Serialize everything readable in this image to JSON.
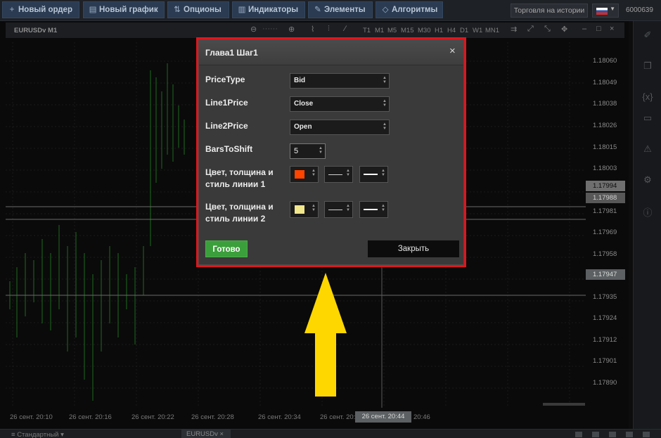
{
  "toolbar": {
    "new_order": "Новый ордер",
    "new_chart": "Новый график",
    "options": "Опционы",
    "indicators": "Индикаторы",
    "elements": "Элементы",
    "algorithms": "Алгоритмы",
    "history_trading": "Торговля на истории",
    "account_id": "6000639"
  },
  "chart": {
    "symbol": "EURUSDv M1",
    "timeframes": [
      "T1",
      "M1",
      "M5",
      "M15",
      "M30",
      "H1",
      "H4",
      "D1",
      "W1",
      "MN1"
    ],
    "price_labels": [
      "1.18060",
      "1.18049",
      "1.18038",
      "1.18026",
      "1.18015",
      "1.18003",
      "1.17981",
      "1.17969",
      "1.17958",
      "1.17935",
      "1.17924",
      "1.17912",
      "1.17901",
      "1.17890"
    ],
    "highlight_prices": [
      "1.17994",
      "1.17988",
      "1.17947"
    ],
    "time_labels": [
      "26 сент. 20:10",
      "26 сент. 20:16",
      "26 сент. 20:22",
      "26 сент. 20:28",
      "26 сент. 20:34",
      "26 сент. 20:40",
      "20:46"
    ],
    "crosshair_time": "26 сент. 20:44"
  },
  "dialog": {
    "title": "Глава1 Шаг1",
    "close_symbol": "×",
    "price_type": {
      "label": "PriceType",
      "value": "Bid"
    },
    "line1_price": {
      "label": "Line1Price",
      "value": "Close"
    },
    "line2_price": {
      "label": "Line2Price",
      "value": "Open"
    },
    "bars_to_shift": {
      "label": "BarsToShift",
      "value": "5"
    },
    "line1_style": {
      "label": "Цвет, толщина и стиль линии 1",
      "color": "#ff4400"
    },
    "line2_style": {
      "label": "Цвет, толщина и стиль линии 2",
      "color": "#f0e68c"
    },
    "ok_label": "Готово",
    "cancel_label": "Закрыть"
  },
  "bottom": {
    "template": "Стандартный",
    "tab": "EURUSDv"
  },
  "annotation": {
    "arrow_color": "#ffd700",
    "outline_color": "#e0151c"
  }
}
